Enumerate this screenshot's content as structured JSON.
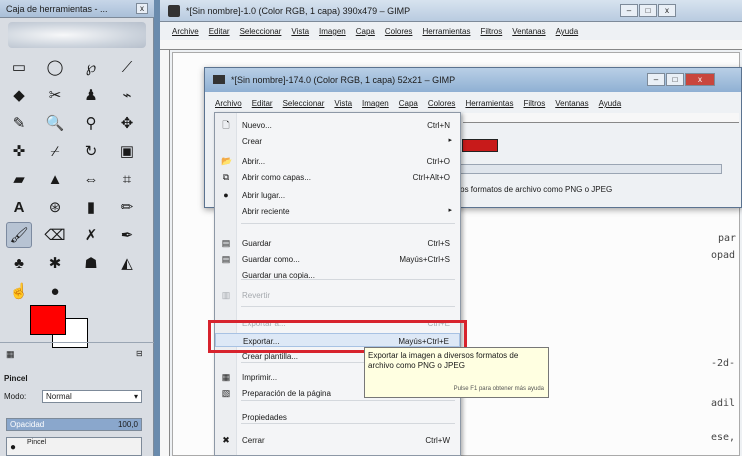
{
  "toolbox": {
    "title": "Caja de herramientas - ...",
    "close_label": "x",
    "tool_options_title": "Pincel",
    "mode_label": "Modo:",
    "mode_value": "Normal",
    "opacity_label": "Opacidad",
    "opacity_value": "100,0",
    "brush_label": "Pincel"
  },
  "main_window": {
    "title": "*[Sin nombre]-1.0 (Color RGB, 1 capa) 390x479 – GIMP",
    "menu": [
      "Archive",
      "Editar",
      "Seleccionar",
      "Vista",
      "Imagen",
      "Capa",
      "Colores",
      "Herramientas",
      "Filtros",
      "Ventanas",
      "Ayuda"
    ],
    "code_fragments": [
      "par",
      "opad",
      "-2d-",
      "adil",
      "ese,"
    ]
  },
  "image_window": {
    "title": "*[Sin nombre]-174.0 (Color RGB, 1 capa) 52x21 – GIMP",
    "menu": [
      "Archivo",
      "Editar",
      "Seleccionar",
      "Vista",
      "Imagen",
      "Capa",
      "Colores",
      "Herramientas",
      "Filtros",
      "Ventanas",
      "Ayuda"
    ],
    "status": "versos formatos de archivo como PNG o JPEG"
  },
  "file_menu": {
    "items": [
      {
        "label": "Nuevo...",
        "shortcut": "Ctrl+N",
        "icon": "new-document-icon"
      },
      {
        "label": "Crear",
        "shortcut": "",
        "icon": "",
        "submenu": true
      },
      {
        "label": "Abrir...",
        "shortcut": "Ctrl+O",
        "icon": "open-folder-icon"
      },
      {
        "label": "Abrir como capas...",
        "shortcut": "Ctrl+Alt+O",
        "icon": "open-as-layers-icon"
      },
      {
        "label": "Abrir lugar...",
        "shortcut": "",
        "icon": "globe-icon"
      },
      {
        "label": "Abrir reciente",
        "shortcut": "",
        "icon": "",
        "submenu": true
      },
      {
        "label": "Guardar",
        "shortcut": "Ctrl+S",
        "icon": "save-icon"
      },
      {
        "label": "Guardar como...",
        "shortcut": "Mayús+Ctrl+S",
        "icon": "save-as-icon"
      },
      {
        "label": "Guardar una copia...",
        "shortcut": "",
        "icon": ""
      },
      {
        "label": "Revertir",
        "shortcut": "",
        "icon": "revert-icon",
        "disabled": true
      },
      {
        "label": "Exportar a...",
        "shortcut": "Ctrl+E",
        "icon": "",
        "disabled": true
      },
      {
        "label": "Exportar...",
        "shortcut": "Mayús+Ctrl+E",
        "icon": ""
      },
      {
        "label": "Crear plantilla...",
        "shortcut": "",
        "icon": ""
      },
      {
        "label": "Imprimir...",
        "shortcut": "",
        "icon": "print-icon"
      },
      {
        "label": "Preparación de la página",
        "shortcut": "",
        "icon": "page-setup-icon"
      },
      {
        "label": "Propiedades",
        "shortcut": "",
        "icon": ""
      },
      {
        "label": "Cerrar",
        "shortcut": "Ctrl+W",
        "icon": "close-x-icon"
      }
    ]
  },
  "tooltip": {
    "text": "Exportar la imagen a diversos formatos de archivo como PNG o JPEG",
    "hint": "Pulse F1 para obtener más ayuda"
  }
}
